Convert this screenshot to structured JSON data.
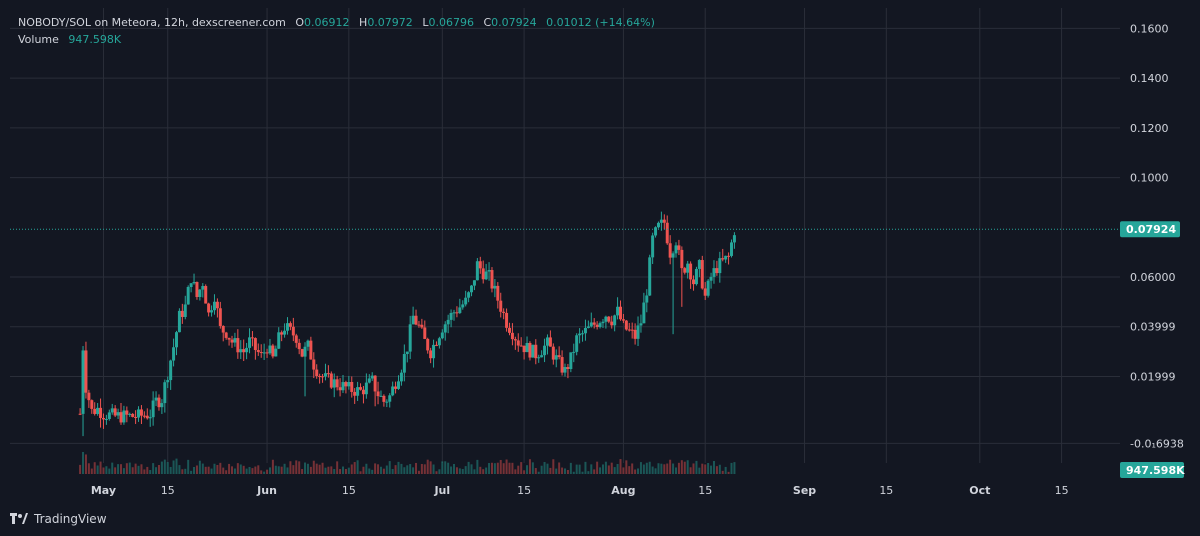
{
  "header": {
    "symbol": "NOBODY/SOL on Meteora, 12h, dexscreener.com",
    "o_label": "O",
    "o_value": "0.06912",
    "h_label": "H",
    "h_value": "0.07972",
    "l_label": "L",
    "l_value": "0.06796",
    "c_label": "C",
    "c_value": "0.07924",
    "change": "0.01012 (+14.64%)",
    "volume_label": "Volume",
    "volume_value": "947.598K"
  },
  "footer": {
    "brand": "TradingView"
  },
  "colors": {
    "up": "#26a69a",
    "down": "#ef5350",
    "bg": "#131722",
    "grid": "#2a2e39",
    "text": "#d1d4dc"
  },
  "chart_data": {
    "type": "candlestick",
    "interval": "12h",
    "y_axis": {
      "ticks": [
        {
          "value": 0.16,
          "label": "0.1600"
        },
        {
          "value": 0.14,
          "label": "0.1400"
        },
        {
          "value": 0.12,
          "label": "0.1200"
        },
        {
          "value": 0.1,
          "label": "0.1000"
        },
        {
          "value": 0.06,
          "label": "0.06000"
        },
        {
          "value": 0.04,
          "label": "0.03999"
        },
        {
          "value": 0.02,
          "label": "0.01999"
        },
        {
          "value": -0.0069,
          "label": "-0.0₁6938"
        }
      ],
      "ylim": [
        -0.012,
        0.165
      ]
    },
    "x_axis": {
      "ticks": [
        {
          "label": "May",
          "day": 4,
          "bold": true
        },
        {
          "label": "15",
          "day": 15,
          "bold": false
        },
        {
          "label": "Jun",
          "day": 32,
          "bold": true
        },
        {
          "label": "15",
          "day": 46,
          "bold": false
        },
        {
          "label": "Jul",
          "day": 62,
          "bold": true
        },
        {
          "label": "15",
          "day": 76,
          "bold": false
        },
        {
          "label": "Aug",
          "day": 93,
          "bold": true
        },
        {
          "label": "15",
          "day": 107,
          "bold": false
        },
        {
          "label": "Sep",
          "day": 124,
          "bold": true
        },
        {
          "label": "15",
          "day": 138,
          "bold": false
        },
        {
          "label": "Oct",
          "day": 154,
          "bold": true
        },
        {
          "label": "15",
          "day": 168,
          "bold": false
        }
      ],
      "day_range": [
        -12,
        178
      ]
    },
    "last_price": {
      "value": 0.07924,
      "label": "0.07924"
    },
    "volume_badge": {
      "label": "947.598K"
    },
    "close_path": [
      [
        0,
        0.005
      ],
      [
        0.5,
        0.032
      ],
      [
        1,
        0.016
      ],
      [
        2,
        0.006
      ],
      [
        3,
        0.007
      ],
      [
        4,
        0.005
      ],
      [
        6,
        0.004
      ],
      [
        8,
        0.004
      ],
      [
        10,
        0.004
      ],
      [
        12,
        0.005
      ],
      [
        13,
        0.01
      ],
      [
        14,
        0.011
      ],
      [
        16,
        0.032
      ],
      [
        17,
        0.044
      ],
      [
        18,
        0.048
      ],
      [
        19,
        0.06
      ],
      [
        20,
        0.052
      ],
      [
        21,
        0.058
      ],
      [
        22,
        0.045
      ],
      [
        23,
        0.053
      ],
      [
        24,
        0.039
      ],
      [
        25,
        0.038
      ],
      [
        26,
        0.034
      ],
      [
        27,
        0.032
      ],
      [
        28,
        0.03
      ],
      [
        29,
        0.034
      ],
      [
        30,
        0.031
      ],
      [
        31,
        0.028
      ],
      [
        32,
        0.032
      ],
      [
        33,
        0.027
      ],
      [
        34,
        0.035
      ],
      [
        35,
        0.04
      ],
      [
        36,
        0.038
      ],
      [
        37,
        0.036
      ],
      [
        38,
        0.029
      ],
      [
        39,
        0.032
      ],
      [
        40,
        0.025
      ],
      [
        41,
        0.021
      ],
      [
        42,
        0.019
      ],
      [
        44,
        0.017
      ],
      [
        46,
        0.015
      ],
      [
        48,
        0.014
      ],
      [
        50,
        0.018
      ],
      [
        51,
        0.013
      ],
      [
        52,
        0.01
      ],
      [
        53,
        0.012
      ],
      [
        55,
        0.024
      ],
      [
        56,
        0.032
      ],
      [
        57,
        0.044
      ],
      [
        58,
        0.04
      ],
      [
        59,
        0.034
      ],
      [
        60,
        0.03
      ],
      [
        61,
        0.035
      ],
      [
        62,
        0.04
      ],
      [
        64,
        0.046
      ],
      [
        66,
        0.05
      ],
      [
        67,
        0.055
      ],
      [
        68,
        0.065
      ],
      [
        69,
        0.062
      ],
      [
        70,
        0.06
      ],
      [
        71,
        0.054
      ],
      [
        72,
        0.048
      ],
      [
        73,
        0.042
      ],
      [
        74,
        0.038
      ],
      [
        75,
        0.034
      ],
      [
        76,
        0.032
      ],
      [
        78,
        0.029
      ],
      [
        80,
        0.033
      ],
      [
        81,
        0.029
      ],
      [
        82,
        0.025
      ],
      [
        83,
        0.022
      ],
      [
        84,
        0.027
      ],
      [
        85,
        0.035
      ],
      [
        86,
        0.037
      ],
      [
        88,
        0.041
      ],
      [
        90,
        0.045
      ],
      [
        91,
        0.043
      ],
      [
        92,
        0.046
      ],
      [
        93,
        0.04
      ],
      [
        94,
        0.038
      ],
      [
        95,
        0.036
      ],
      [
        96,
        0.042
      ],
      [
        97,
        0.055
      ],
      [
        98,
        0.075
      ],
      [
        99,
        0.08
      ],
      [
        100,
        0.082
      ],
      [
        101,
        0.07
      ],
      [
        102,
        0.075
      ],
      [
        103,
        0.062
      ],
      [
        104,
        0.066
      ],
      [
        105,
        0.058
      ],
      [
        106,
        0.064
      ],
      [
        107,
        0.052
      ],
      [
        108,
        0.06
      ],
      [
        109,
        0.064
      ],
      [
        110,
        0.066
      ],
      [
        111,
        0.068
      ],
      [
        112,
        0.079
      ]
    ],
    "volume_notes": "Volume bars shown along the bottom; current volume 947.598K"
  }
}
